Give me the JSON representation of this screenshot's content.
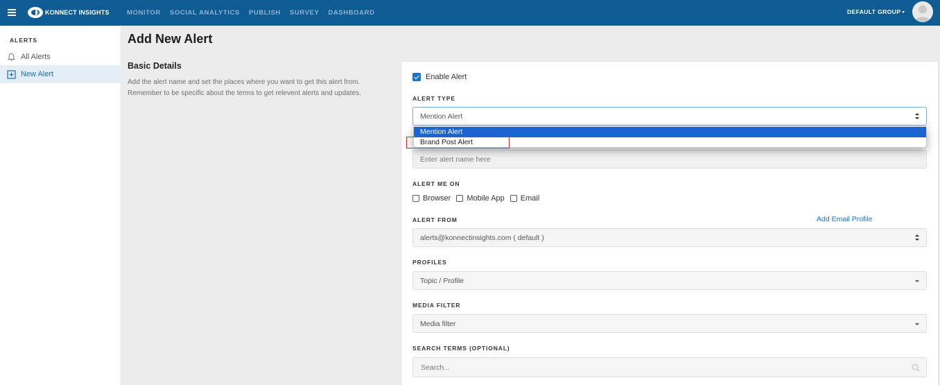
{
  "header": {
    "logo_text": "KONNECT INSIGHTS",
    "nav": [
      "MONITOR",
      "SOCIAL ANALYTICS",
      "PUBLISH",
      "SURVEY",
      "DASHBOARD"
    ],
    "group": "DEFAULT GROUP"
  },
  "sidebar": {
    "title": "ALERTS",
    "items": [
      {
        "label": "All Alerts",
        "icon": "bell-icon"
      },
      {
        "label": "New Alert",
        "icon": "plus-square-icon"
      }
    ]
  },
  "page": {
    "title": "Add New Alert",
    "section_title": "Basic Details",
    "section_desc": "Add the alert name and set the places where you want to get this alert from. Remember to be specific about the terms to get relevent alerts and updates."
  },
  "form": {
    "enable_label": "Enable Alert",
    "enabled": true,
    "alert_type": {
      "label": "ALERT TYPE",
      "value": "Mention Alert",
      "options": [
        "Mention Alert",
        "Brand Post Alert"
      ]
    },
    "alert_name_placeholder": "Enter alert name here",
    "alert_me_on": {
      "label": "ALERT ME ON",
      "options": [
        "Browser",
        "Mobile App",
        "Email"
      ]
    },
    "alert_from": {
      "label": "ALERT FROM",
      "value": "alerts@konnectinsights.com ( default )",
      "add_link": "Add Email Profile"
    },
    "profiles": {
      "label": "PROFILES",
      "value": "Topic / Profile"
    },
    "media_filter": {
      "label": "MEDIA FILTER",
      "value": "Media filter"
    },
    "search_terms": {
      "label": "SEARCH TERMS (OPTIONAL)",
      "placeholder": "Search..."
    }
  },
  "colors": {
    "header_bg": "#0e5c93",
    "accent": "#1a73c8",
    "selected_option": "#1a63d1",
    "highlight_border": "#d92b2b"
  }
}
